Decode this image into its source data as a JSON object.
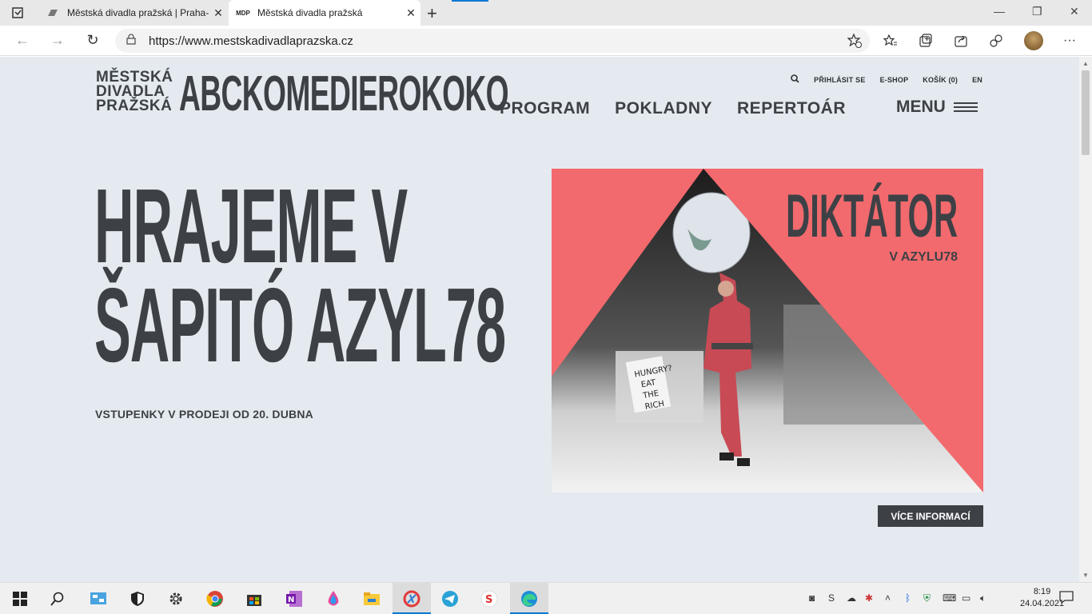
{
  "browser": {
    "tabs": [
      {
        "title": "Městská divadla pražská | Praha-",
        "favicon": "mdp-icon"
      },
      {
        "title": "Městská divadla pražská",
        "favicon": "MDP"
      }
    ],
    "url": "https://www.mestskadivadlaprazska.cz"
  },
  "site": {
    "logo_small": [
      "MĚSTSKÁ",
      "DIVADLA",
      "PRAŽSKÁ"
    ],
    "logo_big": "ABCKOMEDIEROKOKO",
    "util_nav": {
      "login": "PŘIHLÁSIT SE",
      "eshop": "E-SHOP",
      "cart": "KOŠÍK (0)",
      "lang": "EN"
    },
    "main_nav": [
      "PROGRAM",
      "POKLADNY",
      "REPERTOÁR"
    ],
    "menu_label": "MENU",
    "hero": {
      "line1": "HRAJEME V",
      "line2": "ŠAPITÓ AZYL78",
      "sub": "VSTUPENKY V PRODEJI OD 20. DUBNA"
    },
    "banner": {
      "title": "DIKTÁTOR",
      "sub": "V AZYLU78",
      "sign": [
        "HUNGRY?",
        "EAT",
        "THE",
        "RICH"
      ],
      "button": "VÍCE INFORMACÍ"
    }
  },
  "taskbar": {
    "time": "8:19",
    "date": "24.04.2021"
  },
  "colors": {
    "page_bg": "#e4eaef",
    "text_dark": "#3d4146",
    "banner_pink": "#f26a6d",
    "accent_blue": "#0078d4"
  }
}
